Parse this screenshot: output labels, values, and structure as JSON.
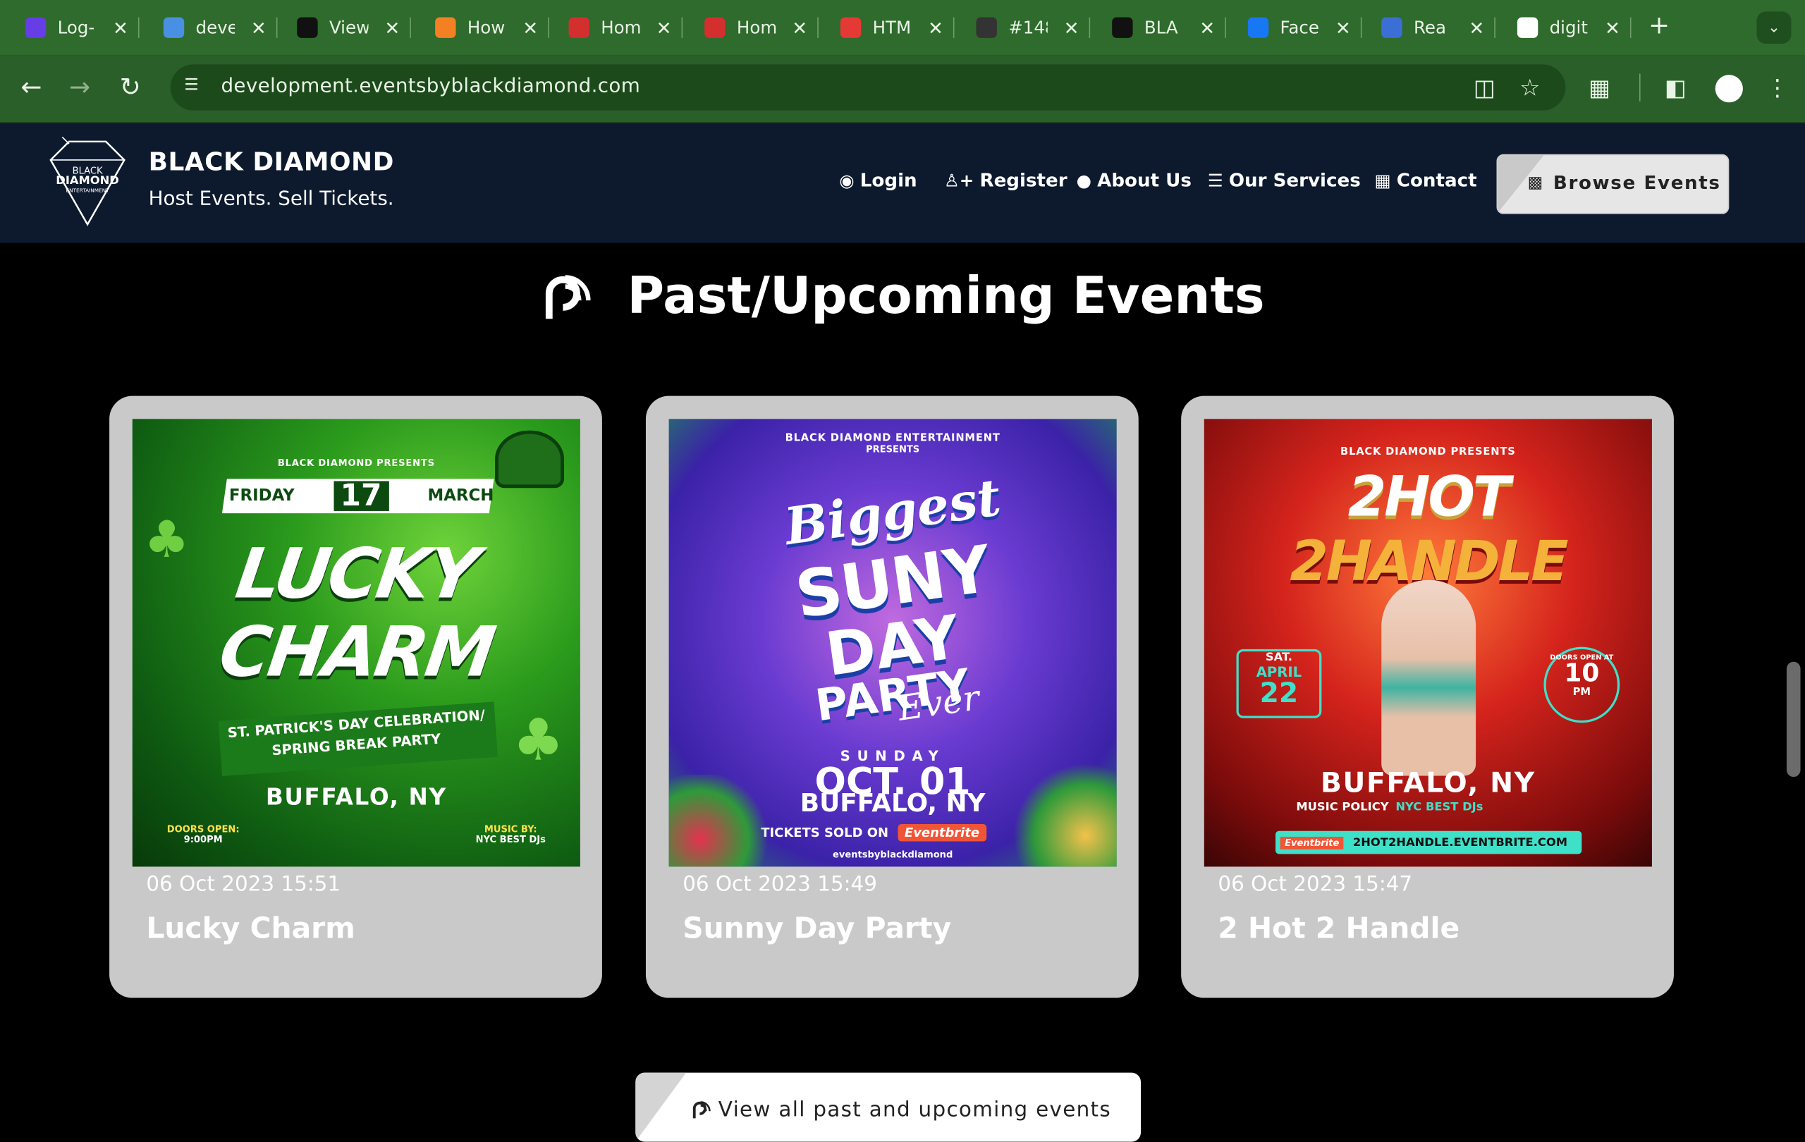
{
  "browser": {
    "tabs": [
      {
        "title": "Log-",
        "icon": "hostinger-icon",
        "color": "#673de6"
      },
      {
        "title": "deve",
        "icon": "globe-icon",
        "color": "#4a90e2"
      },
      {
        "title": "View",
        "icon": "site-icon",
        "color": "#111111"
      },
      {
        "title": "How",
        "icon": "stackoverflow-icon",
        "color": "#f48024"
      },
      {
        "title": "Hom",
        "icon": "y-icon",
        "color": "#d32f2f"
      },
      {
        "title": "Hom",
        "icon": "y-icon",
        "color": "#d32f2f"
      },
      {
        "title": "HTM",
        "icon": "record-icon",
        "color": "#e53935"
      },
      {
        "title": "#148",
        "icon": "pin-icon",
        "color": "#333333"
      },
      {
        "title": "BLA",
        "icon": "blackdiamond-icon",
        "color": "#111111"
      },
      {
        "title": "Face",
        "icon": "facebook-icon",
        "color": "#1877f2"
      },
      {
        "title": "Rea",
        "icon": "flag-icon",
        "color": "#3b6fd6"
      },
      {
        "title": "digit",
        "icon": "google-icon",
        "color": "#ffffff"
      }
    ],
    "url": "development.eventsbyblackdiamond.com"
  },
  "site": {
    "brand": "BLACK DIAMOND",
    "tagline": "Host Events. Sell Tickets.",
    "logo_text": [
      "BLACK",
      "DIAMOND",
      "ENTERTAINMENT"
    ],
    "nav": [
      {
        "label": "Login",
        "icon": "fingerprint-icon"
      },
      {
        "label": "Register",
        "icon": "user-plus-icon"
      },
      {
        "label": "About Us",
        "icon": "map-marker-icon"
      },
      {
        "label": "Our Services",
        "icon": "list-icon"
      },
      {
        "label": "Contact",
        "icon": "grid-icon"
      }
    ],
    "browse_button": "Browse Events"
  },
  "section": {
    "title": "Past/Upcoming Events",
    "view_all": "View all past and upcoming events"
  },
  "events": [
    {
      "date": "06 Oct 2023 15:51",
      "title": "Lucky Charm",
      "poster": {
        "presents": "BLACK DIAMOND PRESENTS",
        "day": "FRIDAY",
        "date_num": "17",
        "month": "MARCH",
        "headline_1": "LUCKY",
        "headline_2": "CHARM",
        "sub_1": "ST. PATRICK'S DAY CELEBRATION/",
        "sub_2": "SPRING BREAK PARTY",
        "city": "BUFFALO, NY",
        "doors_label": "DOORS OPEN:",
        "doors_time": "9:00PM",
        "music_label": "MUSIC BY:",
        "music_value": "NYC BEST DJs"
      }
    },
    {
      "date": "06 Oct 2023 15:49",
      "title": "Sunny Day Party",
      "poster": {
        "presents_1": "BLACK DIAMOND ENTERTAINMENT",
        "presents_2": "PRESENTS",
        "script_1": "Biggest",
        "headline_1": "SUNY",
        "headline_2": "DAY",
        "headline_3": "PARTY",
        "script_2": "Ever",
        "day": "SUNDAY",
        "date_text": "OCT. 01",
        "city": "BUFFALO, NY",
        "tickets": "TICKETS SOLD ON",
        "tickets_brand": "Eventbrite",
        "handle": "eventsbyblackdiamond"
      }
    },
    {
      "date": "06 Oct 2023 15:47",
      "title": "2 Hot 2 Handle",
      "poster": {
        "presents": "BLACK DIAMOND PRESENTS",
        "headline_1": "2HOT",
        "headline_2": "2HANDLE",
        "sat": "SAT.",
        "month": "APRIL",
        "day_num": "22",
        "doors_top": "DOORS OPEN AT",
        "time_num": "10",
        "time_unit": "PM",
        "city": "BUFFALO, NY",
        "music_label": "MUSIC POLICY",
        "music_value": "NYC BEST DJs",
        "brand": "Eventbrite",
        "site": "2HOT2HANDLE.EVENTBRITE.COM"
      }
    }
  ]
}
